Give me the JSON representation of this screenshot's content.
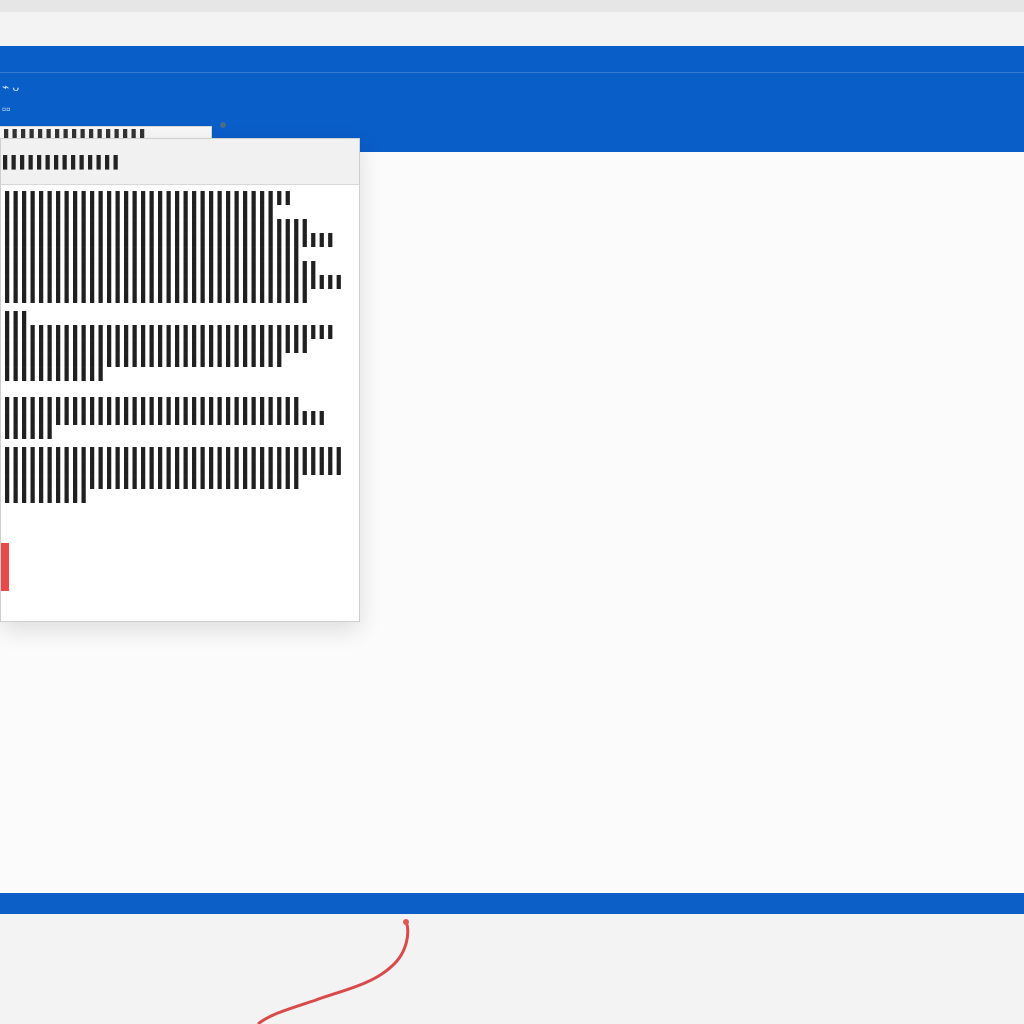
{
  "monitor": {
    "top_labels": [
      "⌁ ᴗ",
      "▫▫"
    ]
  },
  "top_fragment": {
    "text": "▌▌▌▌▌▌▌▌▌▌▌▌▌▌▌▌▌"
  },
  "dialog": {
    "title": "▌▌▌▌▌▌▌▌▌▌▌▌▌▌",
    "lines": [
      "▌▌▌▌▌▌▌▌▌▌▌▌▌▌▌▌▌▌▌▌▌▌▌▌▌▌▌▌▌▌▌▌▌▌",
      "▌▌▌▌▌▌▌▌▌▌▌▌▌▌▌▌▌▌▌▌▌▌▌▌▌▌▌▌▌▌▌▌",
      "▌▌▌▌▌▌▌▌▌▌▌▌▌▌▌▌▌▌▌▌▌▌▌▌▌▌▌▌▌▌▌▌▌▌▌▌",
      "▌▌▌▌▌▌▌▌▌▌▌▌▌▌▌▌▌▌▌▌▌▌▌▌▌▌▌▌▌▌▌▌▌▌▌▌▌▌▌",
      "▌▌▌▌▌▌▌▌▌▌▌▌▌▌▌▌▌▌▌▌▌▌▌▌▌▌▌▌▌▌▌▌▌▌▌",
      "▌▌▌▌▌▌▌▌▌▌▌▌▌▌▌▌▌▌▌▌▌▌▌▌▌▌▌▌▌▌▌▌▌▌▌▌▌",
      "▌▌▌▌▌▌▌▌▌▌▌▌▌▌▌▌▌▌▌▌▌▌▌▌▌▌▌▌▌▌▌▌▌▌▌▌▌▌▌▌",
      "▌▌▌▌▌▌▌▌▌▌▌▌▌▌▌▌▌▌▌▌▌▌▌▌▌▌▌▌▌▌▌▌▌▌▌▌",
      "▌▌▌",
      "▌▌▌▌▌▌▌▌▌▌▌▌▌▌▌▌▌▌▌▌▌▌▌▌▌▌▌▌▌▌▌▌▌▌▌▌▌▌▌",
      "▌▌▌▌▌▌▌▌▌▌▌▌▌▌▌▌▌▌▌▌▌▌▌▌▌▌▌▌▌▌▌▌▌▌▌▌",
      "▌▌▌▌▌▌▌▌▌▌▌▌▌▌▌▌▌▌▌▌▌▌▌▌▌▌▌▌▌▌▌▌▌",
      "▌▌▌▌▌▌▌▌▌▌▌▌",
      "▌▌▌▌▌▌▌▌▌▌▌▌▌▌▌▌▌▌▌▌▌▌▌▌▌▌▌▌▌▌▌▌▌▌▌",
      "▌▌▌▌▌▌▌▌▌▌▌▌▌▌▌▌▌▌▌▌▌▌▌▌▌▌▌▌▌▌▌▌▌▌▌▌▌▌",
      "▌▌▌▌▌▌",
      "▌▌▌▌▌▌▌▌▌▌▌▌▌▌▌▌▌▌▌▌▌▌▌▌▌▌▌▌▌▌▌▌▌▌▌▌▌▌▌▌",
      "▌▌▌▌▌▌▌▌▌▌▌▌▌▌▌▌▌▌▌▌▌▌▌▌▌▌▌▌▌▌▌▌▌▌▌▌▌▌▌▌",
      "▌▌▌▌▌▌▌▌▌▌▌▌▌▌▌▌▌▌▌▌▌▌▌▌▌▌▌▌▌▌▌▌▌▌▌",
      "▌▌▌▌▌▌▌▌▌▌"
    ]
  },
  "colors": {
    "monitor_blue": "#0b5fc7",
    "screen_white": "#fbfbfb",
    "warning_red": "#e84a4a",
    "cable_red": "#d84b4b"
  }
}
